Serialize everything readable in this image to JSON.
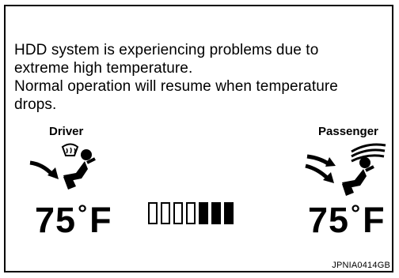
{
  "message": {
    "lines": [
      "HDD system is experiencing problems due to",
      "extreme high temperature.",
      "Normal operation will resume when temperature",
      "drops."
    ]
  },
  "driver": {
    "label": "Driver",
    "temperature": "75",
    "unit": "F",
    "icon": "driver-defrost-seat-airflow-icon"
  },
  "passenger": {
    "label": "Passenger",
    "temperature": "75",
    "unit": "F",
    "icon": "passenger-seat-airflow-icon"
  },
  "fan_level": {
    "total_segments": 7,
    "filled_segments": 3
  },
  "figure_code": "JPNIA0414GB"
}
